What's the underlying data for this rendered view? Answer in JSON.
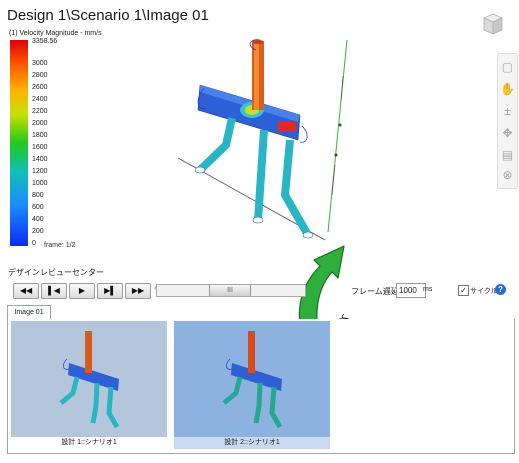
{
  "viewport": {
    "title": "Design 1\\Scenario 1\\Image 01",
    "legend_title": "(1) Velocity Magnitude - mm/s",
    "legend_ticks": [
      "3358.56",
      "3000",
      "2800",
      "2600",
      "2400",
      "2200",
      "2000",
      "1800",
      "1600",
      "1400",
      "1200",
      "1000",
      "800",
      "600",
      "400",
      "200",
      "0"
    ],
    "frame_label": "frame: 1/2"
  },
  "side_toolbar": {
    "icons": [
      "zoom-window-icon",
      "pan-hand-icon",
      "zoom-icon",
      "orbit-icon",
      "section-icon",
      "reset-view-icon"
    ]
  },
  "design_center": {
    "label": "デザインレビューセンター",
    "buttons": [
      "first",
      "prev",
      "play",
      "next",
      "last"
    ],
    "slider_thumb": "III",
    "frame_delay_label": "フレーム遅延",
    "frame_delay_value": "1000",
    "frame_delay_unit": "ms",
    "cycle_label": "サイクル",
    "cycle_checked": true,
    "help": "?"
  },
  "tabs": [
    {
      "label": "Image 01",
      "selected": true
    }
  ],
  "thumbnails": [
    {
      "caption": "設計 1::シナリオ1",
      "selected": false
    },
    {
      "caption": "設計 2::シナリオ1",
      "selected": true
    }
  ],
  "colors": {
    "selection": "#8db2e0",
    "arrow": "#2fae3c"
  }
}
